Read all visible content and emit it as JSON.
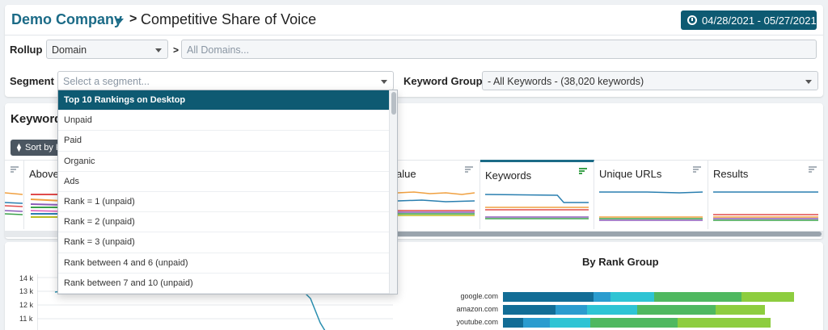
{
  "header": {
    "company": "Demo Company",
    "separator": ">",
    "title": "Competitive Share of Voice",
    "date_range": "04/28/2021 - 05/27/2021"
  },
  "rollup": {
    "label": "Rollup",
    "value": "Domain",
    "arrow": ">",
    "filter_placeholder": "All Domains..."
  },
  "segment": {
    "label": "Segment",
    "placeholder": "Select a segment...",
    "options": [
      "Top 10 Rankings on Desktop",
      "Unpaid",
      "Paid",
      "Organic",
      "Ads",
      "Rank = 1 (unpaid)",
      "Rank = 2 (unpaid)",
      "Rank = 3 (unpaid)",
      "Rank between 4 and 6 (unpaid)",
      "Rank between 7 and 10 (unpaid)"
    ],
    "selected_index": 0
  },
  "keyword_group": {
    "label": "Keyword Group",
    "value": "- All Keywords - (38,020 keywords)"
  },
  "keywords_panel": {
    "title": "Keyword",
    "sort_button": "Sort by K",
    "metrics": [
      {
        "label": "",
        "key": "m0"
      },
      {
        "label": "Above t",
        "key": "m1"
      },
      {
        "label": "alue",
        "key": "m2"
      },
      {
        "label": "Keywords",
        "key": "m3",
        "active": true
      },
      {
        "label": "Unique URLs",
        "key": "m4"
      },
      {
        "label": "Results",
        "key": "m5"
      }
    ]
  },
  "rank_chart": {
    "title": "By Rank Group",
    "domains": [
      "google.com",
      "amazon.com",
      "youtube.com"
    ],
    "segment_colors": [
      "#126d96",
      "#2a9ccf",
      "#2ec4d4",
      "#4fb860",
      "#8dcd3f"
    ],
    "rows": [
      [
        0.31,
        0.06,
        0.15,
        0.3,
        0.18
      ],
      [
        0.18,
        0.11,
        0.17,
        0.27,
        0.17
      ],
      [
        0.07,
        0.09,
        0.14,
        0.3,
        0.32
      ]
    ]
  },
  "line_chart": {
    "y_ticks": [
      "14 k",
      "13 k",
      "12 k",
      "11 k"
    ]
  },
  "colors": {
    "brand": "#1b6b87",
    "date_button": "#0e5a72",
    "selected": "#0e5a72"
  }
}
